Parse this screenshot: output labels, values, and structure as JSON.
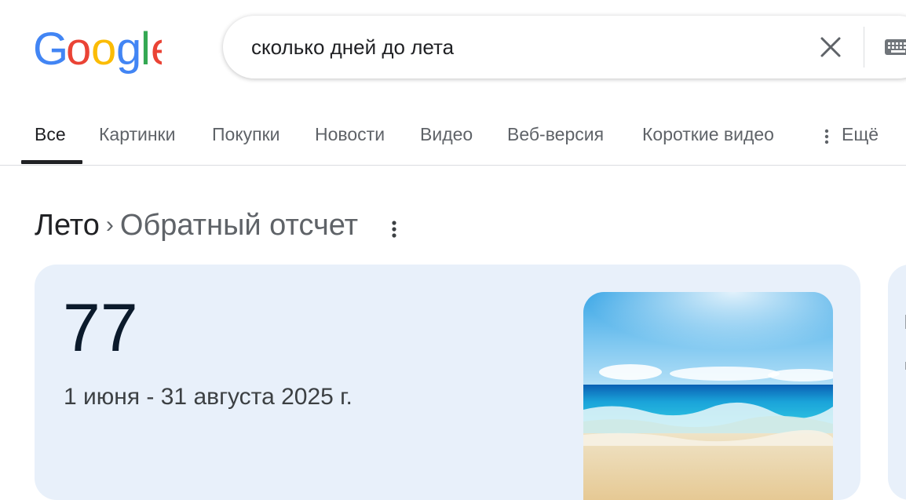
{
  "search": {
    "query": "сколько дней до лета",
    "clear_icon": "close-icon",
    "keyboard_icon": "keyboard-icon"
  },
  "tabs": [
    {
      "label": "Все",
      "active": true
    },
    {
      "label": "Картинки",
      "active": false
    },
    {
      "label": "Покупки",
      "active": false
    },
    {
      "label": "Новости",
      "active": false
    },
    {
      "label": "Видео",
      "active": false
    },
    {
      "label": "Веб-версия",
      "active": false
    },
    {
      "label": "Короткие видео",
      "active": false
    }
  ],
  "more": {
    "label": "Ещё",
    "icon": "more-vert-icon"
  },
  "breadcrumb": {
    "root": "Лето",
    "separator": "›",
    "current": "Обратный отсчет",
    "menu_icon": "more-vert-icon"
  },
  "countdown": {
    "days": "77",
    "date_range": "1 июня - 31 августа 2025 г.",
    "image": "beach-photo"
  },
  "colors": {
    "card_bg": "#e8f0fa",
    "google_blue": "#4285f4",
    "google_red": "#ea4335",
    "google_yellow": "#fbbc05",
    "google_green": "#34a853"
  }
}
